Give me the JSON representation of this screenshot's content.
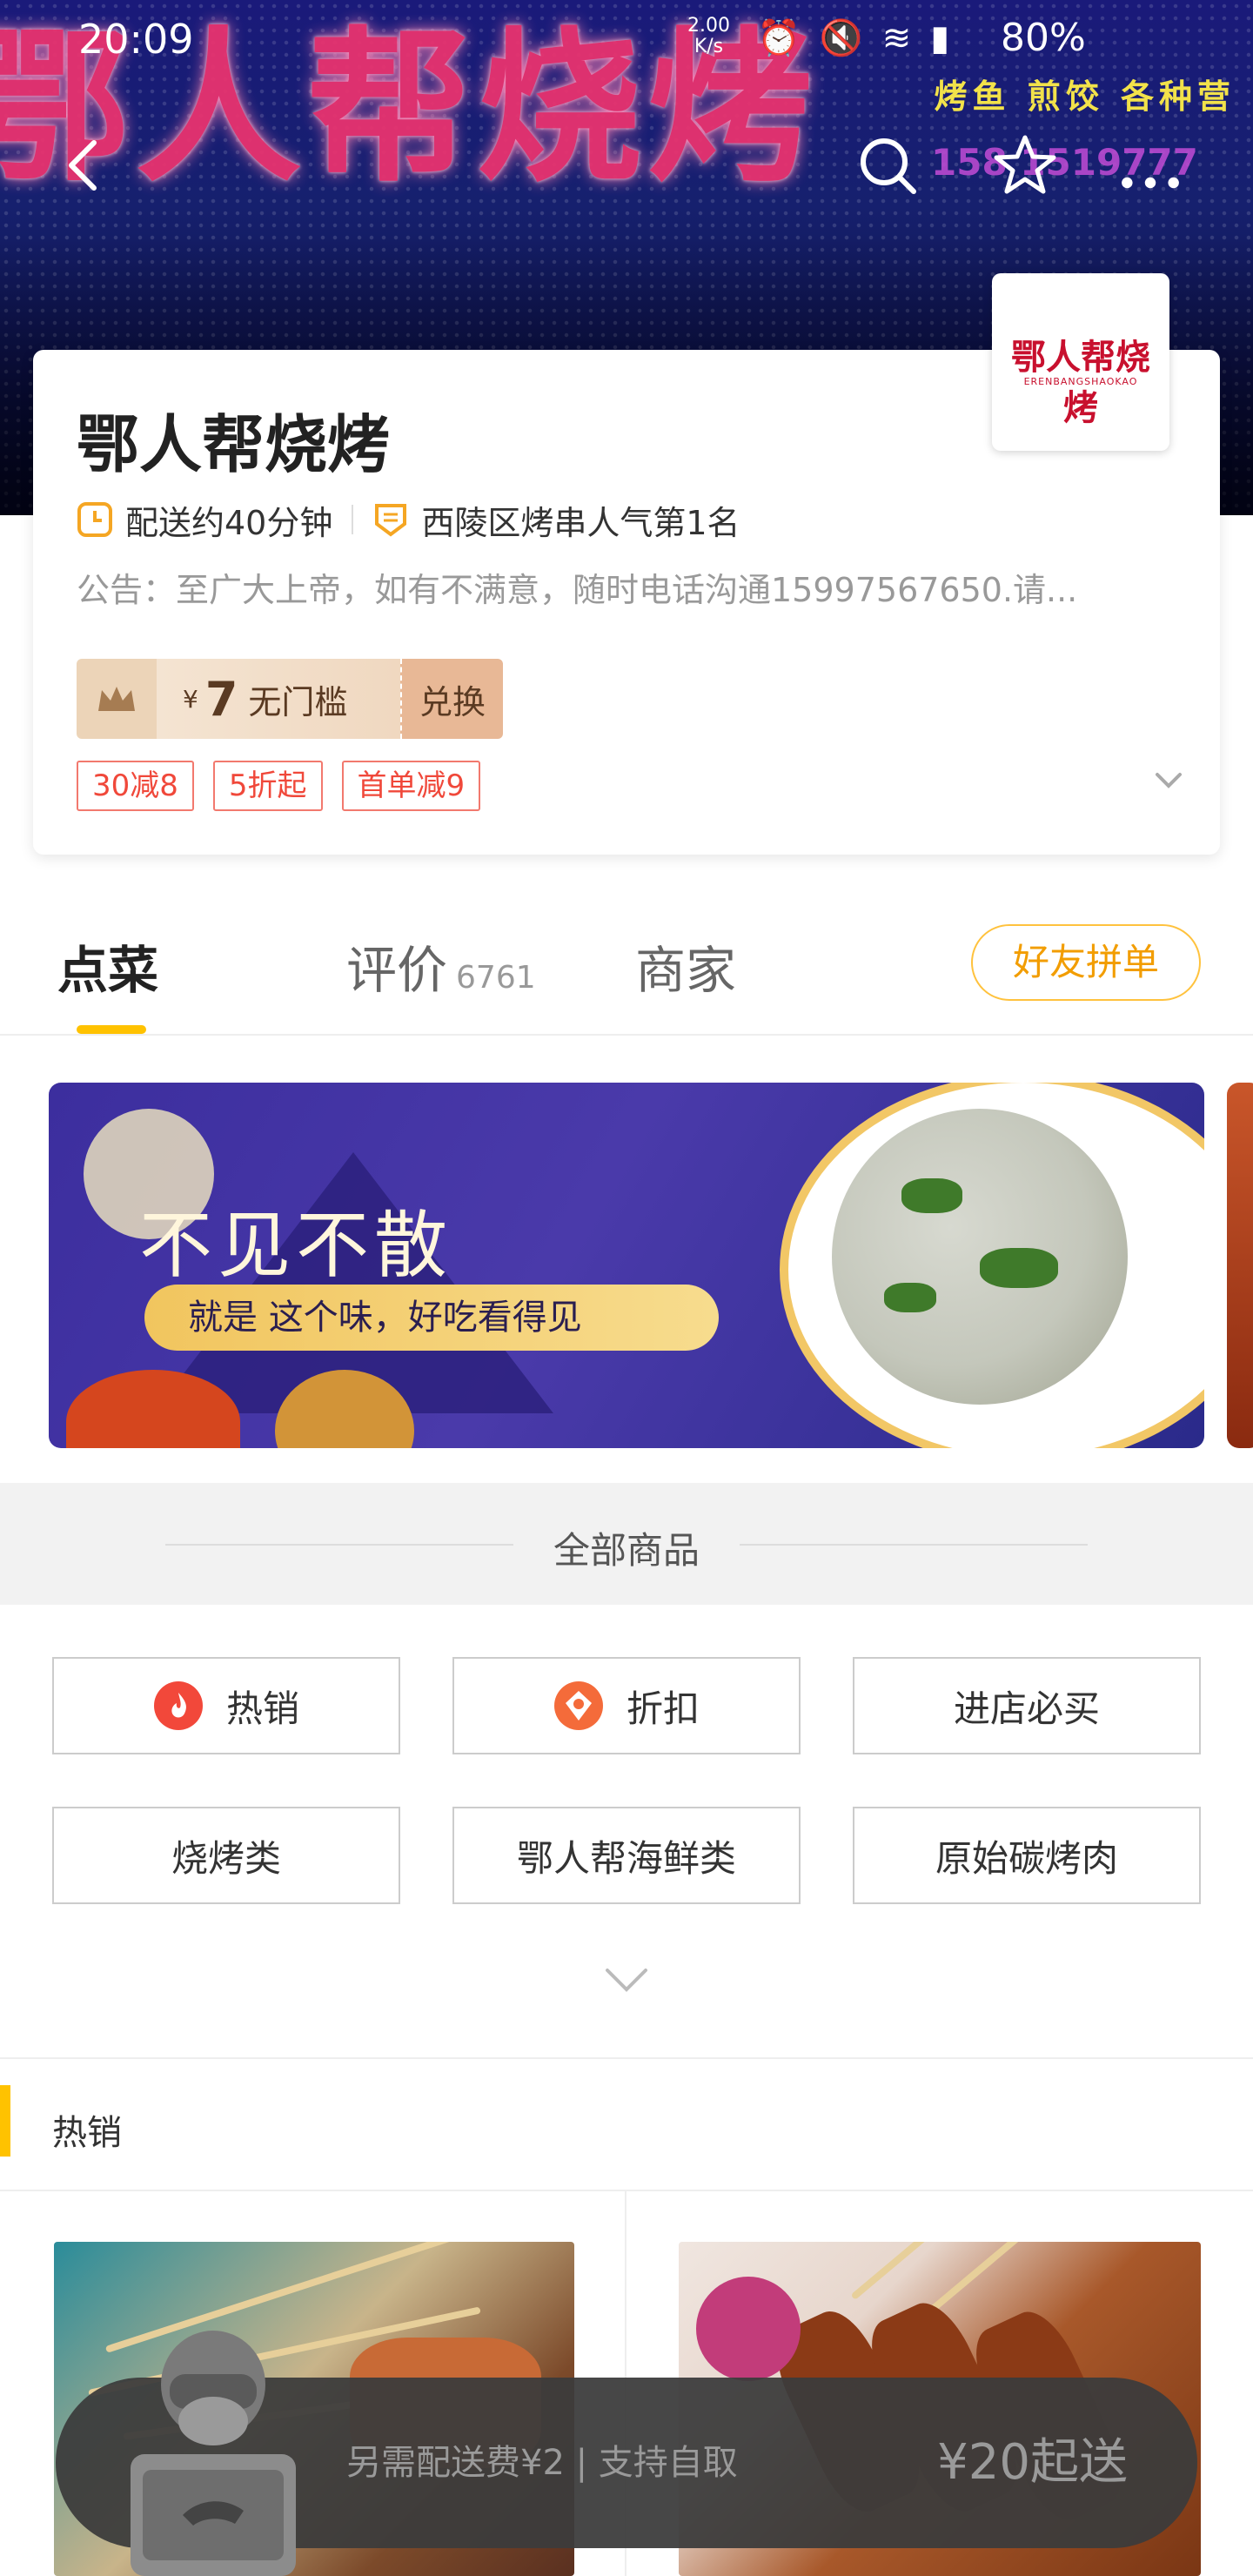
{
  "status_bar": {
    "time": "20:09",
    "net_rate": "2.00",
    "net_unit": "K/s",
    "battery": "80%"
  },
  "hero": {
    "sign_text": "鄂人帮烧烤",
    "side_text": "烤鱼 煎饺 各种营",
    "phone_text": "158 1519777"
  },
  "shop": {
    "name": "鄂人帮烧烤",
    "delivery_time": "配送约40分钟",
    "ranking": "西陵区烤串人气第1名",
    "notice": "公告：至广大上帝，如有不满意，随时电话沟通15997567650.请...",
    "logo_text": "鄂人帮烧烤",
    "logo_sub": "ERENBANGSHAOKAO"
  },
  "voucher": {
    "currency": "¥",
    "amount": "7",
    "condition": "无门槛",
    "action": "兑换"
  },
  "discounts": [
    "30减8",
    "5折起",
    "首单减9"
  ],
  "tabs": {
    "order": "点菜",
    "review": "评价",
    "review_count": "6761",
    "merchant": "商家",
    "group_order": "好友拼单"
  },
  "promo": {
    "title": "不见不散",
    "subtitle": "就是 这个味，好吃看得见"
  },
  "all_products": {
    "label": "全部商品",
    "categories": [
      {
        "label": "热销",
        "icon": "flame-icon"
      },
      {
        "label": "折扣",
        "icon": "discount-icon"
      },
      {
        "label": "进店必买",
        "icon": ""
      },
      {
        "label": "烧烤类",
        "icon": ""
      },
      {
        "label": "鄂人帮海鲜类",
        "icon": ""
      },
      {
        "label": "原始碳烤肉",
        "icon": ""
      }
    ]
  },
  "hot_section": {
    "title": "热销"
  },
  "cart": {
    "delivery_note": "另需配送费¥2 | 支持自取",
    "min_order": "¥20起送"
  },
  "colors": {
    "accent": "#ffc200",
    "discount_red": "#f0483a",
    "group_orange": "#f29d00"
  }
}
